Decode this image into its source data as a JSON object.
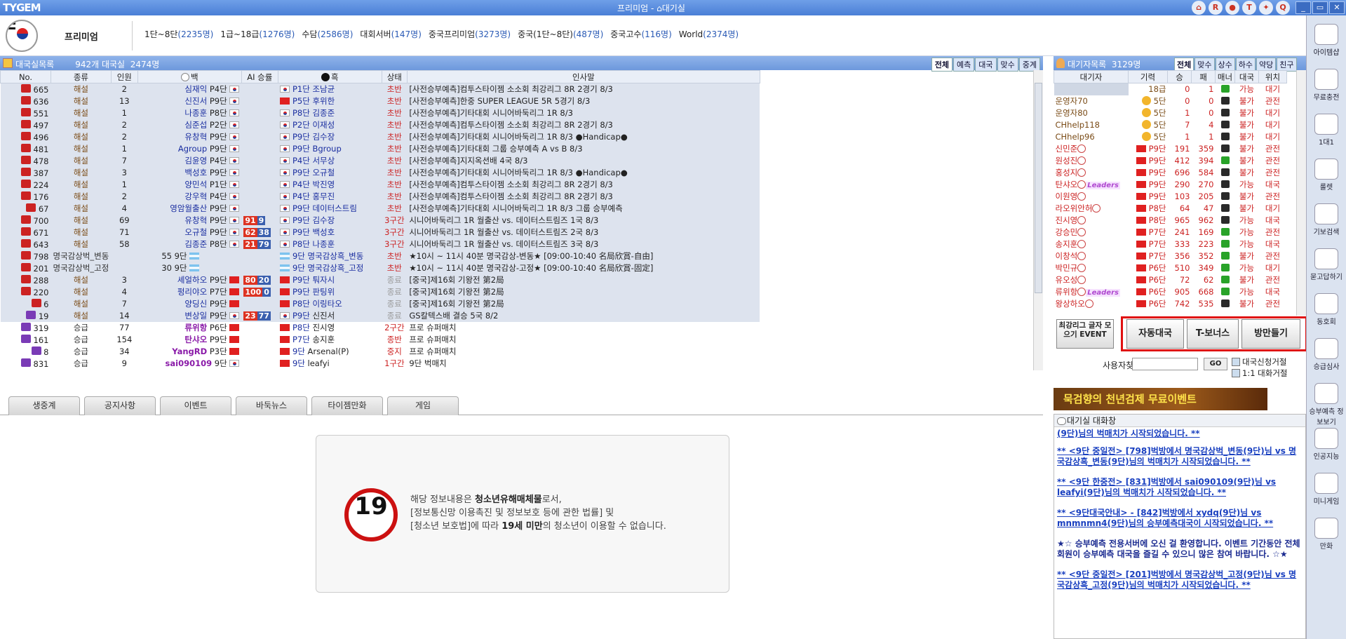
{
  "titlebar": {
    "logo": "TYGEM",
    "title": "프리미엄 - ⌂대기실",
    "icons": [
      "home-icon",
      "rank-icon",
      "ball-icon",
      "t-icon",
      "bulb-icon",
      "quiz-icon"
    ]
  },
  "stats": {
    "premium": "프리미엄",
    "servers": [
      {
        "name": "1단~8단",
        "count": "(2235명)"
      },
      {
        "name": "1급~18급",
        "count": "(1276명)"
      },
      {
        "name": "수담",
        "count": "(2586명)"
      },
      {
        "name": "대회서버",
        "count": "(147명)"
      },
      {
        "name": "중국프리미엄",
        "count": "(3273명)"
      },
      {
        "name": "중국(1단~8단)",
        "count": "(487명)"
      },
      {
        "name": "중국고수",
        "count": "(116명)"
      },
      {
        "name": "World",
        "count": "(2374명)"
      }
    ]
  },
  "games_header": {
    "label": "대국실목록",
    "summary": "942개 대국실",
    "count": "2474명",
    "tabs": [
      "전체",
      "예측",
      "대국",
      "맞수",
      "중계"
    ]
  },
  "games_columns": [
    "No.",
    "종류",
    "인원",
    "백",
    "AI 승률",
    "흑",
    "상태",
    "인사말"
  ],
  "games": [
    {
      "no": "665",
      "kind": "해설",
      "num": "2",
      "w": "심재익",
      "wr": "P4단",
      "wf": "k",
      "ai": "",
      "bf": "k",
      "br": "P1단",
      "b": "조남균",
      "st": "초반",
      "msg": "[사전승부예측]컴투스타이젬 소소회 최강리그 8R  2경기 8/3"
    },
    {
      "no": "636",
      "kind": "해설",
      "num": "13",
      "w": "신진서",
      "wr": "P9단",
      "wf": "k",
      "ai": "",
      "bf": "c",
      "br": "P5단",
      "b": "후위한",
      "st": "초반",
      "msg": "[사전승부예측]한중 SUPER LEAGUE 5R  5경기 8/3"
    },
    {
      "no": "551",
      "kind": "해설",
      "num": "1",
      "w": "나종훈",
      "wr": "P8단",
      "wf": "k",
      "ai": "",
      "bf": "k",
      "br": "P8단",
      "b": "김종준",
      "st": "초반",
      "msg": "[사전승부예측]기타대회 시니어바둑리그 1R 8/3"
    },
    {
      "no": "497",
      "kind": "해설",
      "num": "2",
      "w": "심준섭",
      "wr": "P2단",
      "wf": "k",
      "ai": "",
      "bf": "k",
      "br": "P2단",
      "b": "이재성",
      "st": "초반",
      "msg": "[사전승부예측]컴투스타이젬 소소회 최강리그 8R  2경기 8/3"
    },
    {
      "no": "496",
      "kind": "해설",
      "num": "2",
      "w": "유창혁",
      "wr": "P9단",
      "wf": "k",
      "ai": "",
      "bf": "k",
      "br": "P9단",
      "b": "김수장",
      "st": "초반",
      "msg": "[사전승부예측]기타대회 시니어바둑리그 1R 8/3 ●Handicap●"
    },
    {
      "no": "481",
      "kind": "해설",
      "num": "1",
      "w": "Agroup",
      "wr": "P9단",
      "wf": "k",
      "ai": "",
      "bf": "k",
      "br": "P9단",
      "b": "Bgroup",
      "st": "초반",
      "msg": "[사전승부예측]기타대회 그룹 승부예측 A vs B 8/3"
    },
    {
      "no": "478",
      "kind": "해설",
      "num": "7",
      "w": "김윤영",
      "wr": "P4단",
      "wf": "k",
      "ai": "",
      "bf": "k",
      "br": "P4단",
      "b": "서무상",
      "st": "초반",
      "msg": "[사전승부예측]지지옥션배 4국  8/3"
    },
    {
      "no": "387",
      "kind": "해설",
      "num": "3",
      "w": "백성호",
      "wr": "P9단",
      "wf": "k",
      "ai": "",
      "bf": "k",
      "br": "P9단",
      "b": "오규철",
      "st": "초반",
      "msg": "[사전승부예측]기타대회 시니어바둑리그 1R 8/3 ●Handicap●"
    },
    {
      "no": "224",
      "kind": "해설",
      "num": "1",
      "w": "양민석",
      "wr": "P1단",
      "wf": "k",
      "ai": "",
      "bf": "k",
      "br": "P4단",
      "b": "박진영",
      "st": "초반",
      "msg": "[사전승부예측]컴투스타이젬 소소회 최강리그 8R  2경기 8/3"
    },
    {
      "no": "176",
      "kind": "해설",
      "num": "2",
      "w": "강우혁",
      "wr": "P4단",
      "wf": "k",
      "ai": "",
      "bf": "k",
      "br": "P4단",
      "b": "홍무진",
      "st": "초반",
      "msg": "[사전승부예측]컴투스타이젬 소소회 최강리그 8R  2경기 8/3"
    },
    {
      "no": "67",
      "kind": "해설",
      "num": "4",
      "w": "영암월출산",
      "wr": "P9단",
      "wf": "k",
      "ai": "",
      "bf": "k",
      "br": "P9단",
      "b": "데이터스트림",
      "st": "초반",
      "msg": "[사전승부예측]기타대회 시니어바둑리그 1R 8/3 그룹 승부예측"
    },
    {
      "no": "700",
      "kind": "해설",
      "num": "69",
      "w": "유창혁",
      "wr": "P9단",
      "wf": "k",
      "ai": "91 9",
      "bf": "k",
      "br": "P9단",
      "b": "김수장",
      "st": "3구간",
      "msg": "시니어바둑리그 1R 월출산 vs. 데이터스트림즈 1국 8/3"
    },
    {
      "no": "671",
      "kind": "해설",
      "num": "71",
      "w": "오규철",
      "wr": "P9단",
      "wf": "k",
      "ai": "62 38",
      "bf": "k",
      "br": "P9단",
      "b": "백성호",
      "st": "3구간",
      "msg": "시니어바둑리그 1R 월출산 vs. 데이터스트림즈 2국 8/3"
    },
    {
      "no": "643",
      "kind": "해설",
      "num": "58",
      "w": "김종준",
      "wr": "P8단",
      "wf": "k",
      "ai": "21 79",
      "bf": "k",
      "br": "P8단",
      "b": "나종훈",
      "st": "3구간",
      "msg": "시니어바둑리그 1R 월출산 vs. 데이터스트림즈 3국 8/3"
    },
    {
      "no": "798",
      "kind": "명국감상벅_변동",
      "num": "55",
      "w": "",
      "wr": "9단",
      "wf": "a",
      "ai": "",
      "bf": "a",
      "br": "9단",
      "b": "명국감상흑_변동",
      "st": "초반",
      "msg": "★10시 ~ 11시 40분 명국감상-변동★ [09:00-10:40 名局欣賞-自由]"
    },
    {
      "no": "201",
      "kind": "명국감상벅_고정",
      "num": "30",
      "w": "",
      "wr": "9단",
      "wf": "a",
      "ai": "",
      "bf": "a",
      "br": "9단",
      "b": "명국감상흑_고정",
      "st": "초반",
      "msg": "★10시 ~ 11시 40분 명국감상-고정★ [09:00-10:40 名局欣賞-固定]"
    },
    {
      "no": "288",
      "kind": "해설",
      "num": "3",
      "w": "셰얼하오",
      "wr": "P9단",
      "wf": "c",
      "ai": "80 20",
      "bf": "c",
      "br": "P9단",
      "b": "퉈자시",
      "st": "종료",
      "msg": "[중국]제16회 기왕전 第2局"
    },
    {
      "no": "220",
      "kind": "해설",
      "num": "4",
      "w": "펑리야오",
      "wr": "P7단",
      "wf": "c",
      "ai": "100 0",
      "bf": "c",
      "br": "P9단",
      "b": "판팅위",
      "st": "종료",
      "msg": "[중국]제16회 기왕전 第2局"
    },
    {
      "no": "6",
      "kind": "해설",
      "num": "7",
      "w": "양딩신",
      "wr": "P9단",
      "wf": "c",
      "ai": "",
      "bf": "c",
      "br": "P8단",
      "b": "이링타오",
      "st": "종료",
      "msg": "[중국]제16회 기왕전 第2局"
    },
    {
      "no": "19",
      "kind": "해설",
      "num": "14",
      "w": "변상일",
      "wr": "P9단",
      "wf": "k",
      "ai": "23 77",
      "bf": "k",
      "br": "P9단",
      "b": "신진서",
      "st": "종료",
      "msg": "GS칼텍스배 결승 5국 8/2"
    },
    {
      "no": "319",
      "kind": "승급",
      "num": "77",
      "w": "류위항",
      "wr": "P6단",
      "wf": "c",
      "ai": "",
      "bf": "c",
      "br": "P8단",
      "b": "진시영",
      "st": "2구간",
      "msg": "프로 슈퍼매치"
    },
    {
      "no": "161",
      "kind": "승급",
      "num": "154",
      "w": "탄샤오",
      "wr": "P9단",
      "wf": "c",
      "ai": "",
      "bf": "c",
      "br": "P7단",
      "b": "송지훈",
      "st": "종반",
      "msg": "프로 슈퍼매치"
    },
    {
      "no": "8",
      "kind": "승급",
      "num": "34",
      "w": "YangRD",
      "wr": "P3단",
      "wf": "c",
      "ai": "",
      "bf": "c",
      "br": "9단",
      "b": "Arsenal(P)",
      "st": "중지",
      "msg": "프로 슈퍼매치"
    },
    {
      "no": "831",
      "kind": "승급",
      "num": "9",
      "w": "sai090109",
      "wr": "9단",
      "wf": "k",
      "ai": "",
      "bf": "c",
      "br": "9단",
      "b": "leafyi",
      "st": "1구간",
      "msg": "9단 벅매치"
    }
  ],
  "bottom_tabs": [
    "생중계",
    "공지사항",
    "이벤트",
    "바둑뉴스",
    "타이젬만화",
    "게임"
  ],
  "notice": {
    "age": "19",
    "line1_pre": "해당 정보내용은 ",
    "line1_bold": "청소년유해매체물",
    "line1_post": "로서,",
    "line2": "[정보통신망 이용촉진 및 정보보호 등에 관한 법률] 및",
    "line3_pre": "[청소년 보호법]에 따라 ",
    "line3_bold": "19세 미만",
    "line3_post": "의 청소년이 이용할 수 없습니다."
  },
  "users_header": {
    "label": "대기자목록",
    "count": "3129명",
    "tabs": [
      "전체",
      "맞수",
      "상수",
      "하수",
      "약당",
      "친구"
    ]
  },
  "users_columns": [
    "대기자",
    "기력",
    "승",
    "패",
    "매너",
    "대국",
    "위치"
  ],
  "users": [
    {
      "n": "",
      "r": "18급",
      "w": "0",
      "l": "1",
      "m": "g",
      "d": "가능",
      "p": "대기",
      "c": "brown"
    },
    {
      "n": "운영자70",
      "r": "5단",
      "w": "0",
      "l": "0",
      "m": "k",
      "d": "불가",
      "p": "관전",
      "c": "brown"
    },
    {
      "n": "운영자80",
      "r": "5단",
      "w": "1",
      "l": "0",
      "m": "k",
      "d": "불가",
      "p": "대기",
      "c": "brown"
    },
    {
      "n": "CHhelp118",
      "r": "5단",
      "w": "7",
      "l": "4",
      "m": "k",
      "d": "불가",
      "p": "대기",
      "c": "brown"
    },
    {
      "n": "CHhelp96",
      "r": "5단",
      "w": "1",
      "l": "1",
      "m": "k",
      "d": "불가",
      "p": "대기",
      "c": "brown"
    },
    {
      "n": "신민준",
      "r": "P9단",
      "w": "191",
      "l": "359",
      "m": "k",
      "d": "불가",
      "p": "관전",
      "c": "red"
    },
    {
      "n": "원성진",
      "r": "P9단",
      "w": "412",
      "l": "394",
      "m": "g",
      "d": "불가",
      "p": "관전",
      "c": "red"
    },
    {
      "n": "홍성지",
      "r": "P9단",
      "w": "696",
      "l": "584",
      "m": "k",
      "d": "불가",
      "p": "관전",
      "c": "red"
    },
    {
      "n": "탄샤오",
      "r": "P9단",
      "w": "290",
      "l": "270",
      "m": "k",
      "d": "가능",
      "p": "대국",
      "c": "red"
    },
    {
      "n": "이원영",
      "r": "P9단",
      "w": "103",
      "l": "205",
      "m": "k",
      "d": "불가",
      "p": "관전",
      "c": "red"
    },
    {
      "n": "라오위안허",
      "r": "P8단",
      "w": "64",
      "l": "47",
      "m": "k",
      "d": "불가",
      "p": "대기",
      "c": "red"
    },
    {
      "n": "진시영",
      "r": "P8단",
      "w": "965",
      "l": "962",
      "m": "k",
      "d": "가능",
      "p": "대국",
      "c": "red"
    },
    {
      "n": "강승민",
      "r": "P7단",
      "w": "241",
      "l": "169",
      "m": "g",
      "d": "가능",
      "p": "관전",
      "c": "red"
    },
    {
      "n": "송지훈",
      "r": "P7단",
      "w": "333",
      "l": "223",
      "m": "g",
      "d": "가능",
      "p": "대국",
      "c": "red"
    },
    {
      "n": "이창석",
      "r": "P7단",
      "w": "356",
      "l": "352",
      "m": "g",
      "d": "불가",
      "p": "관전",
      "c": "red"
    },
    {
      "n": "박민규",
      "r": "P6단",
      "w": "510",
      "l": "349",
      "m": "g",
      "d": "가능",
      "p": "대기",
      "c": "red"
    },
    {
      "n": "유오성",
      "r": "P6단",
      "w": "72",
      "l": "62",
      "m": "g",
      "d": "불가",
      "p": "관전",
      "c": "red"
    },
    {
      "n": "류위항",
      "r": "P6단",
      "w": "905",
      "l": "668",
      "m": "g",
      "d": "가능",
      "p": "대국",
      "c": "red"
    },
    {
      "n": "왕상하오",
      "r": "P6단",
      "w": "742",
      "l": "535",
      "m": "k",
      "d": "불가",
      "p": "관전",
      "c": "red"
    }
  ],
  "buttons": {
    "event": "최강리그 글자 모으기 EVENT",
    "auto": "자동대국",
    "bonus": "T-보너스",
    "make": "방만들기"
  },
  "search": {
    "label": "사용자찾기",
    "go": "GO",
    "chk1": "대국신청거절",
    "chk2": "1:1 대화거절"
  },
  "banner": "묵검향의 천년검제 무료이벤트",
  "chat": {
    "header": "대기실 대화창",
    "messages": [
      "(9단)님의 벅매치가 시작되었습니다. **",
      "** <9단 중일전> [798]벅방에서 명국감상벅_변동(9단)님 vs 명국감상흑_변동(9단)님의 벅매치가 시작되었습니다. **",
      "** <9단 한중전> [831]벅방에서 sai090109(9단)님 vs leafyi(9단)님의 벅매치가 시작되었습니다. **",
      "** <9단대국안내> - [842]벅방에서 xydq(9단)님 vs mnmnmn4(9단)님의 승부예측대국이 시작되었습니다. **",
      "★☆ 승부예측 전용서버에 오신 걸 환영합니다. 이벤트 기간동안 전체 회원이 승부예측 대국을 즐길 수 있으니 많은 참여 바랍니다. ☆★",
      "** <9단 중일전> [201]벅방에서 명국감상벅_고정(9단)님 vs 명국감상흑_고정(9단)님의 벅매치가 시작되었습니다. **"
    ]
  },
  "side": [
    "아이템샵",
    "무료충전",
    "1대1",
    "룰렛",
    "기보검색",
    "묻고답하기",
    "동호회",
    "승급심사",
    "승부예측 정보보기",
    "인공지능",
    "미니게임",
    "만화"
  ]
}
